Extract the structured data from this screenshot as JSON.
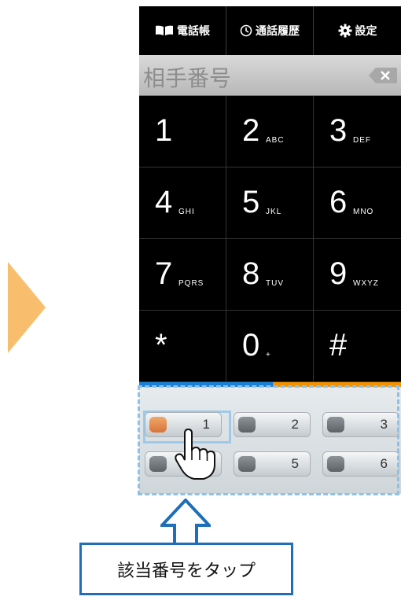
{
  "tabs": [
    {
      "label": "電話帳",
      "icon": "book-icon"
    },
    {
      "label": "通話履歴",
      "icon": "clock-icon"
    },
    {
      "label": "設定",
      "icon": "gear-icon"
    }
  ],
  "display": {
    "placeholder": "相手番号",
    "backspace_icon": "backspace-icon"
  },
  "keypad": [
    {
      "digit": "1",
      "letters": ""
    },
    {
      "digit": "2",
      "letters": "ABC"
    },
    {
      "digit": "3",
      "letters": "DEF"
    },
    {
      "digit": "4",
      "letters": "GHI"
    },
    {
      "digit": "5",
      "letters": "JKL"
    },
    {
      "digit": "6",
      "letters": "MNO"
    },
    {
      "digit": "7",
      "letters": "PQRS"
    },
    {
      "digit": "8",
      "letters": "TUV"
    },
    {
      "digit": "9",
      "letters": "WXYZ"
    },
    {
      "digit": "*",
      "letters": ""
    },
    {
      "digit": "0",
      "letters": "+"
    },
    {
      "digit": "#",
      "letters": ""
    }
  ],
  "speed_dial": [
    "1",
    "2",
    "3",
    "4",
    "5",
    "6"
  ],
  "callout": {
    "text": "該当番号をタップ"
  },
  "colors": {
    "accent_blue": "#1a7fd6",
    "accent_orange": "#f39200",
    "side_arrow": "#f9be6d",
    "highlight": "#8ec1e8",
    "callout_border": "#1e6fb7"
  }
}
